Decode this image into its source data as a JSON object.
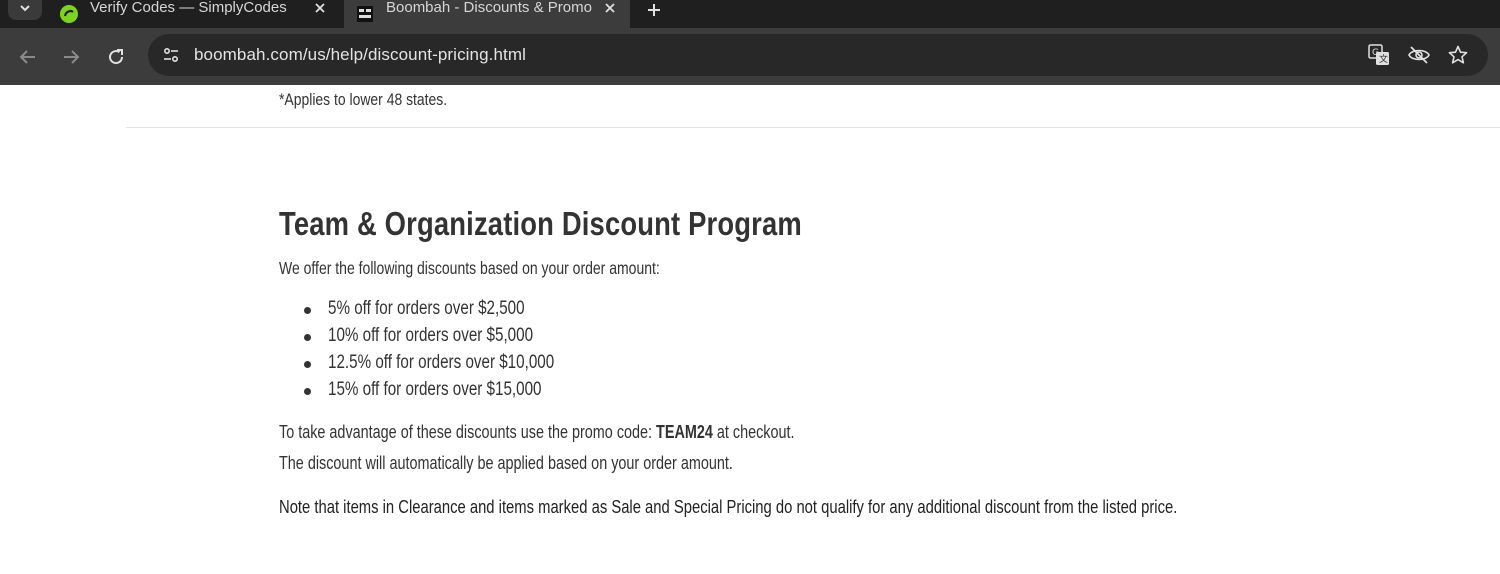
{
  "browser": {
    "tabs": [
      {
        "title": "Verify Codes — SimplyCodes",
        "active": false,
        "favicon": "simplycodes-favicon"
      },
      {
        "title": "Boombah - Discounts & Promo",
        "active": true,
        "favicon": "boombah-favicon"
      }
    ],
    "url": "boombah.com/us/help/discount-pricing.html",
    "icons": {
      "tab_list": "chevron-down-icon",
      "new_tab": "plus-icon",
      "back": "back-arrow-icon",
      "forward": "forward-arrow-icon",
      "reload": "reload-icon",
      "site_info": "tune-icon",
      "translate": "translate-icon",
      "tracking": "eye-off-icon",
      "bookmark": "star-icon"
    },
    "colors": {
      "tabbar": "#1f1f1f",
      "toolbar": "#3c3c3c",
      "omnibox": "#282828",
      "simplycodes_green": "#7ed321"
    }
  },
  "page": {
    "footnote": "*Applies to lower 48 states.",
    "heading": "Team & Organization Discount Program",
    "intro": "We offer the following discounts based on your order amount:",
    "tiers": [
      "5% off for orders over $2,500",
      "10% off for orders over $5,000",
      "12.5% off for orders over $10,000",
      "15% off for orders over $15,000"
    ],
    "promo_prefix": "To take advantage of these discounts use the promo code: ",
    "promo_code": "TEAM24",
    "promo_suffix": " at checkout.",
    "auto_applied": "The discount will automatically be applied based on your order amount.",
    "note": "Note that items in Clearance and items marked as Sale and Special Pricing do not qualify for any additional discount from the listed price."
  }
}
